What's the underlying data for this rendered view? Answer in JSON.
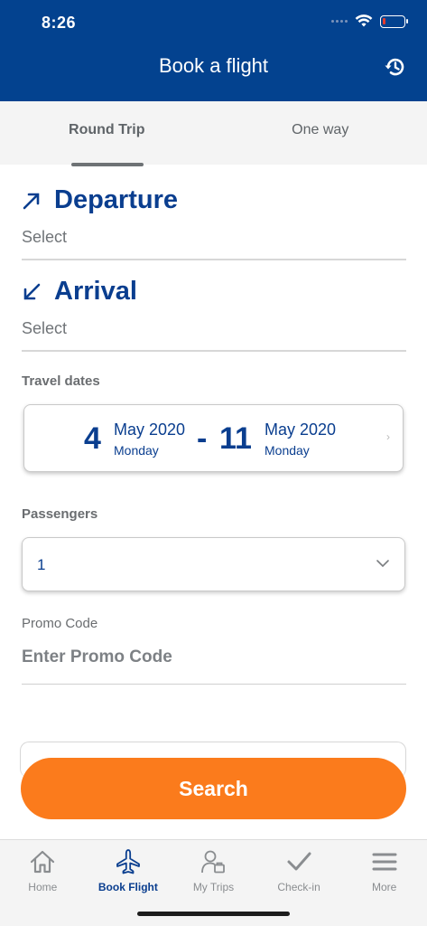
{
  "status_bar": {
    "time": "8:26"
  },
  "header": {
    "title": "Book a flight",
    "history_icon": "history-icon"
  },
  "tabs": [
    {
      "label": "Round Trip",
      "active": true
    },
    {
      "label": "One way",
      "active": false
    }
  ],
  "departure": {
    "title": "Departure",
    "value": "Select",
    "icon": "arrow-up-right-icon"
  },
  "arrival": {
    "title": "Arrival",
    "value": "Select",
    "icon": "arrow-down-left-icon"
  },
  "travel_dates": {
    "label": "Travel dates",
    "start": {
      "day": "4",
      "month_year": "May 2020",
      "weekday": "Monday"
    },
    "separator": "-",
    "end": {
      "day": "11",
      "month_year": "May 2020",
      "weekday": "Monday"
    },
    "chevron": "›"
  },
  "passengers": {
    "label": "Passengers",
    "value": "1"
  },
  "promo": {
    "label": "Promo Code",
    "placeholder": "Enter Promo Code"
  },
  "search_button": {
    "label": "Search"
  },
  "bottom_nav": [
    {
      "label": "Home",
      "icon": "home-icon",
      "active": false
    },
    {
      "label": "Book Flight",
      "icon": "airplane-icon",
      "active": true
    },
    {
      "label": "My Trips",
      "icon": "trips-icon",
      "active": false
    },
    {
      "label": "Check-in",
      "icon": "checkmark-icon",
      "active": false
    },
    {
      "label": "More",
      "icon": "menu-icon",
      "active": false
    }
  ],
  "colors": {
    "brand": "#03428f",
    "accent": "#fb7b1c",
    "text_primary": "#0a3e8f"
  }
}
